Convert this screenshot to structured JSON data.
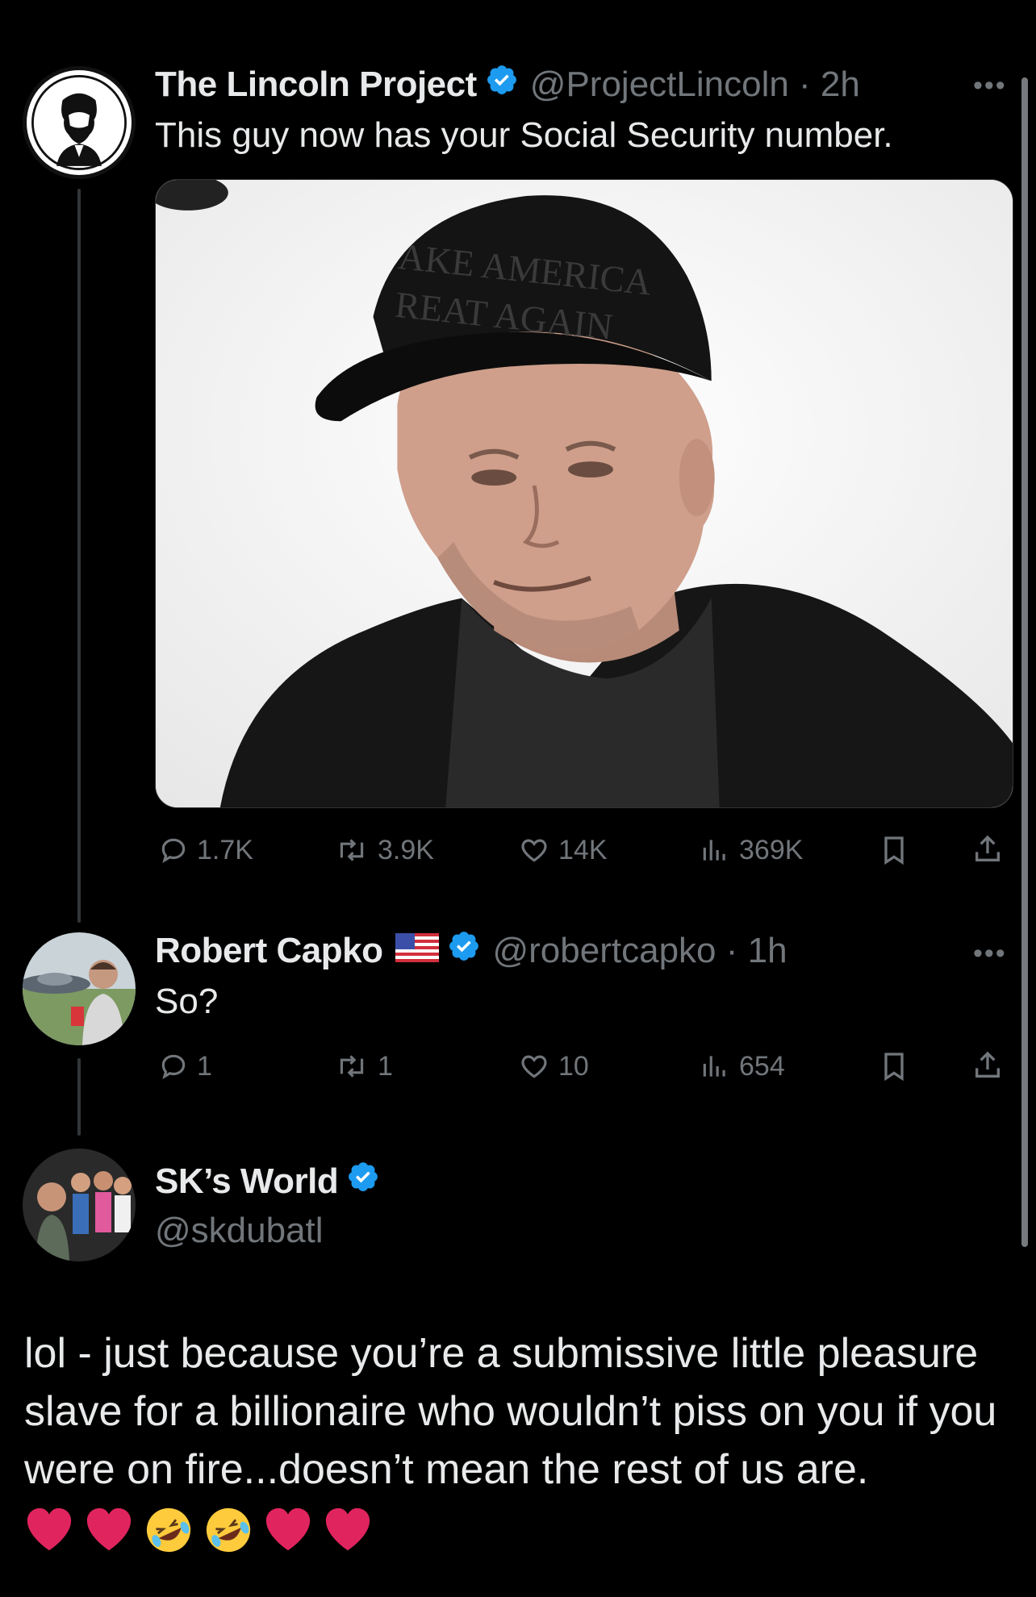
{
  "tweets": [
    {
      "name": "The Lincoln Project",
      "handle_time": "@ProjectLincoln · 2h",
      "text": "This guy now has your Social Security number.",
      "media_caption_lines": [
        "AKE AMERICA",
        "REAT AGAIN"
      ],
      "stats": {
        "replies": "1.7K",
        "reposts": "3.9K",
        "likes": "14K",
        "views": "369K"
      }
    },
    {
      "name": "Robert Capko",
      "handle_time": "@robertcapko · 1h",
      "text": "So?",
      "stats": {
        "replies": "1",
        "reposts": "1",
        "likes": "10",
        "views": "654"
      }
    }
  ],
  "reply_card": {
    "name": "SK’s World",
    "handle": "@skdubatl",
    "body": "lol - just because you’re a submissive little pleasure slave for a billionaire who wouldn’t piss on you if you were on fire...doesn’t mean the rest of us are."
  },
  "more_label": "•••",
  "colors": {
    "accent": "#1d9bf0",
    "muted": "#71767b",
    "text": "#e7e9ea",
    "heart": "#e0245e"
  },
  "emoji_sequence": [
    "heart-emoji",
    "heart-emoji",
    "rofl-emoji",
    "rofl-emoji",
    "heart-emoji",
    "heart-emoji"
  ]
}
